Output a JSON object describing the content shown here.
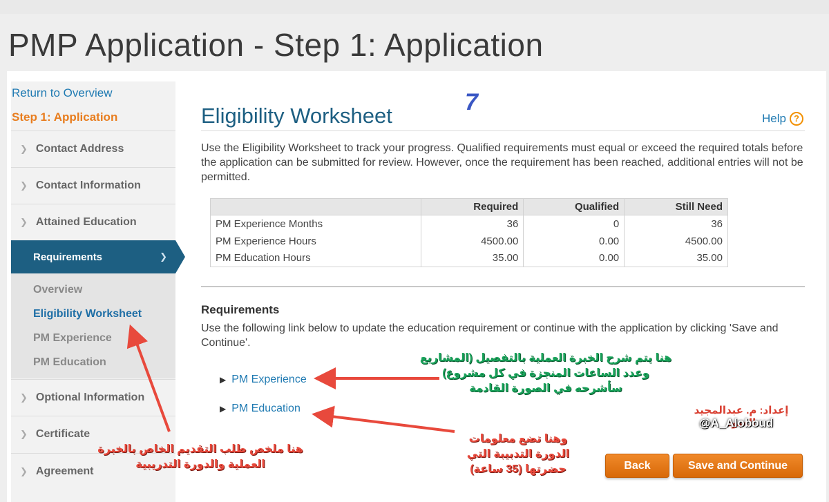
{
  "page": {
    "title": "PMP Application - Step 1: Application"
  },
  "sidebar": {
    "return_link": "Return to Overview",
    "step_title": "Step 1: Application",
    "items": [
      {
        "label": "Contact Address"
      },
      {
        "label": "Contact Information"
      },
      {
        "label": "Attained Education"
      },
      {
        "label": "Requirements"
      },
      {
        "label": "Optional Information"
      },
      {
        "label": "Certificate"
      },
      {
        "label": "Agreement"
      }
    ],
    "sub_items": [
      {
        "label": "Overview"
      },
      {
        "label": "Eligibility Worksheet"
      },
      {
        "label": "PM Experience"
      },
      {
        "label": "PM Education"
      }
    ]
  },
  "main": {
    "title": "Eligibility Worksheet",
    "help_label": "Help",
    "intro": "Use the Eligibility Worksheet to track your progress. Qualified requirements must equal or exceed the required totals before the application can be submitted for review. However, once the requirement has been reached, additional entries will not be permitted.",
    "table": {
      "headers": [
        "",
        "Required",
        "Qualified",
        "Still Need"
      ],
      "rows": [
        {
          "label": "PM Experience Months",
          "required": "36",
          "qualified": "0",
          "still_need": "36"
        },
        {
          "label": "PM Experience Hours",
          "required": "4500.00",
          "qualified": "0.00",
          "still_need": "4500.00"
        },
        {
          "label": "PM Education Hours",
          "required": "35.00",
          "qualified": "0.00",
          "still_need": "35.00"
        }
      ]
    },
    "requirements_heading": "Requirements",
    "requirements_text": "Use the following link below to update the education requirement or continue with the application by clicking 'Save and Continue'.",
    "links": [
      {
        "label": "PM Experience"
      },
      {
        "label": "PM Education"
      }
    ],
    "buttons": {
      "back": "Back",
      "save_continue": "Save and Continue"
    }
  },
  "annotations": {
    "step_number": "7",
    "experience_note": [
      "هنا يتم شرح الخبرة العملية بالتفصيل (المشاريع",
      "وعدد الساعات المنجزة في كل مشروع)",
      "سأشرحه في الصورة القادمة"
    ],
    "education_note": [
      "وهنا تضع معلومات",
      "الدورة التدبيبة التي",
      "حضرتها (35 ساعة)"
    ],
    "sidebar_note": [
      "هنا ملخص طلب التقديم الخاص بالخبرة",
      "العملية والدورة التدريبية"
    ],
    "credit": "إعداد: م. عبدالمجيد العبود",
    "handle": "@A_Aloboud",
    "colors": {
      "green": "#19a25a",
      "red": "#e8493c",
      "blue": "#3a57c4"
    }
  },
  "colors": {
    "brand_blue": "#1d5f82",
    "link": "#1f7ab2",
    "orange": "#e87d1e"
  }
}
